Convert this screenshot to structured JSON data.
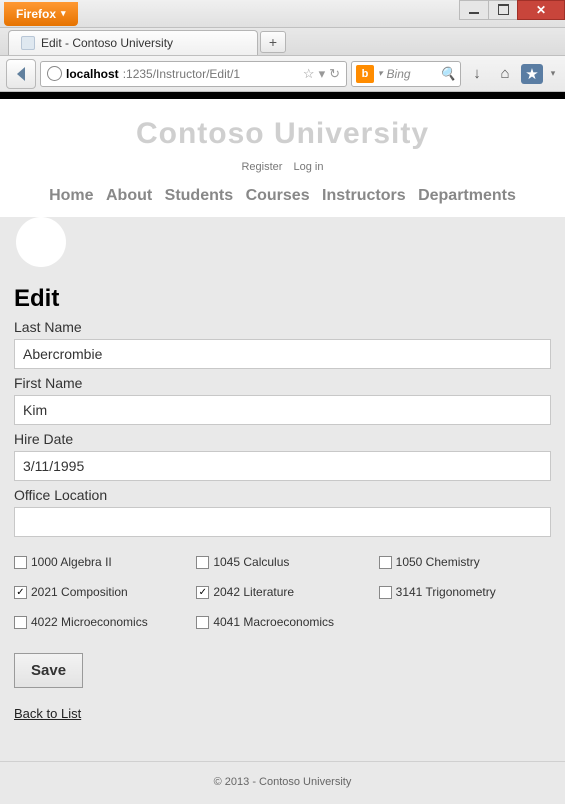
{
  "browser": {
    "name": "Firefox",
    "tab_title": "Edit - Contoso University",
    "url_host": "localhost",
    "url_path": ":1235/Instructor/Edit/1",
    "search_engine": "Bing",
    "search_icon_letter": "b",
    "newtab_symbol": "+",
    "star_symbol": "☆",
    "dropdown_symbol": "▾",
    "refresh_symbol": "↻",
    "magnifier_symbol": "🔍",
    "download_symbol": "↓",
    "home_symbol": "⌂",
    "bookmark_symbol": "★"
  },
  "site": {
    "title": "Contoso University",
    "register_label": "Register",
    "login_label": "Log in",
    "nav": {
      "home": "Home",
      "about": "About",
      "students": "Students",
      "courses": "Courses",
      "instructors": "Instructors",
      "departments": "Departments"
    }
  },
  "form": {
    "heading": "Edit",
    "labels": {
      "last_name": "Last Name",
      "first_name": "First Name",
      "hire_date": "Hire Date",
      "office_location": "Office Location"
    },
    "values": {
      "last_name": "Abercrombie",
      "first_name": "Kim",
      "hire_date": "3/11/1995",
      "office_location": ""
    },
    "courses": [
      {
        "label": "1000 Algebra II",
        "checked": false
      },
      {
        "label": "1045 Calculus",
        "checked": false
      },
      {
        "label": "1050 Chemistry",
        "checked": false
      },
      {
        "label": "2021 Composition",
        "checked": true
      },
      {
        "label": "2042 Literature",
        "checked": true
      },
      {
        "label": "3141 Trigonometry",
        "checked": false
      },
      {
        "label": "4022 Microeconomics",
        "checked": false
      },
      {
        "label": "4041 Macroeconomics",
        "checked": false
      }
    ],
    "save_label": "Save",
    "back_label": "Back to List"
  },
  "footer": "© 2013 - Contoso University"
}
